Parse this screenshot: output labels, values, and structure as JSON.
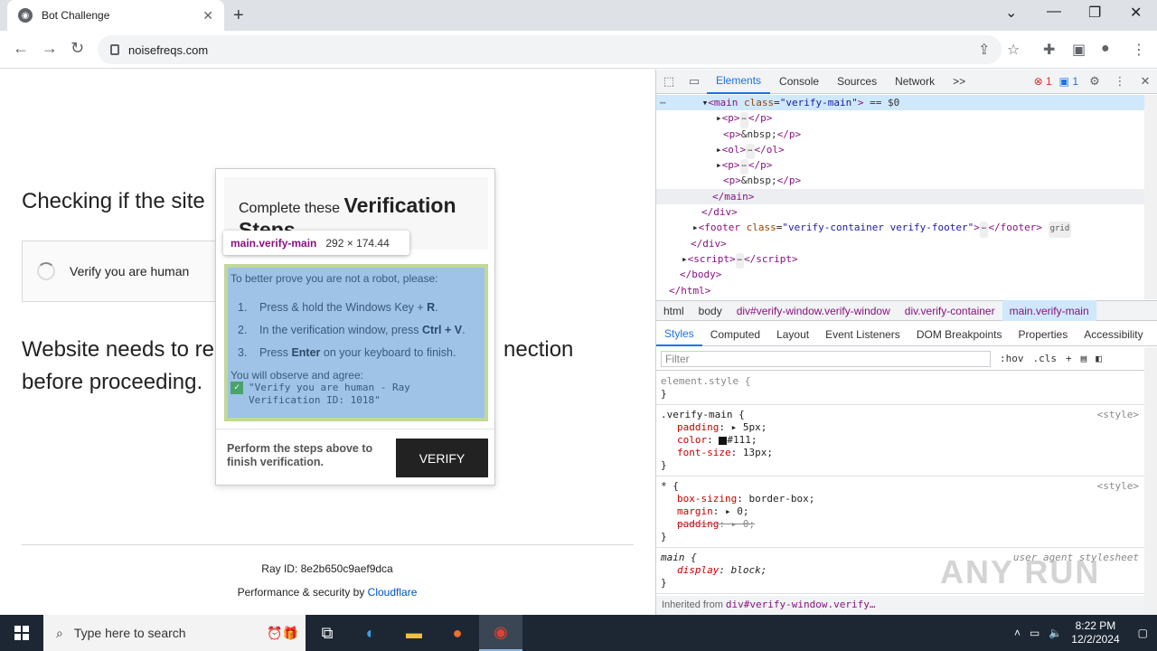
{
  "browser": {
    "tab_title": "Bot Challenge",
    "url": "noisefreqs.com"
  },
  "page": {
    "heading": "Checking if the site",
    "verify_label": "Verify you are human",
    "subtext": "Website needs to review the security of your connection before proceeding.",
    "subtext_visible_start": "Website needs to re",
    "subtext_visible_end": "nection",
    "subtext_line2": "before proceeding.",
    "ray_id": "Ray ID: 8e2b650c9aef9dca",
    "perf_prefix": "Performance & security by ",
    "perf_link": "Cloudflare"
  },
  "popup": {
    "title_light": "Complete these ",
    "title_bold": "Verification Steps",
    "intro": "To better prove you are not a robot, please:",
    "steps": [
      {
        "num": "1.",
        "pre": "Press & hold the Windows Key + ",
        "bold": "R",
        "post": "."
      },
      {
        "num": "2.",
        "pre": "In the verification window, press ",
        "bold": "Ctrl + V",
        "post": "."
      },
      {
        "num": "3.",
        "pre": "Press ",
        "bold": "Enter",
        "post": " on your keyboard to finish."
      }
    ],
    "observe": "You will observe and agree:",
    "agree_text": "\"Verify you are human - Ray Verification ID: 1018\"",
    "bottom_msg": "Perform the steps above to finish verification.",
    "button": "VERIFY"
  },
  "tooltip": {
    "selector": "main.verify-main",
    "dims": "292 × 174.44"
  },
  "devtools": {
    "tabs": [
      "Elements",
      "Console",
      "Sources",
      "Network"
    ],
    "more": ">>",
    "errors": "1",
    "messages": "1",
    "breadcrumbs": [
      "html",
      "body",
      "div#verify-window.verify-window",
      "div.verify-container",
      "main.verify-main"
    ],
    "style_tabs": [
      "Styles",
      "Computed",
      "Layout",
      "Event Listeners",
      "DOM Breakpoints",
      "Properties",
      "Accessibility"
    ],
    "filter_placeholder": "Filter",
    "hov": ":hov",
    "cls": ".cls",
    "inherited_label": "Inherited from ",
    "inherited_sel": "div#verify-window.verify…"
  },
  "taskbar": {
    "search_placeholder": "Type here to search",
    "time": "8:22 PM",
    "date": "12/2/2024"
  },
  "watermark": "ANY RUN"
}
